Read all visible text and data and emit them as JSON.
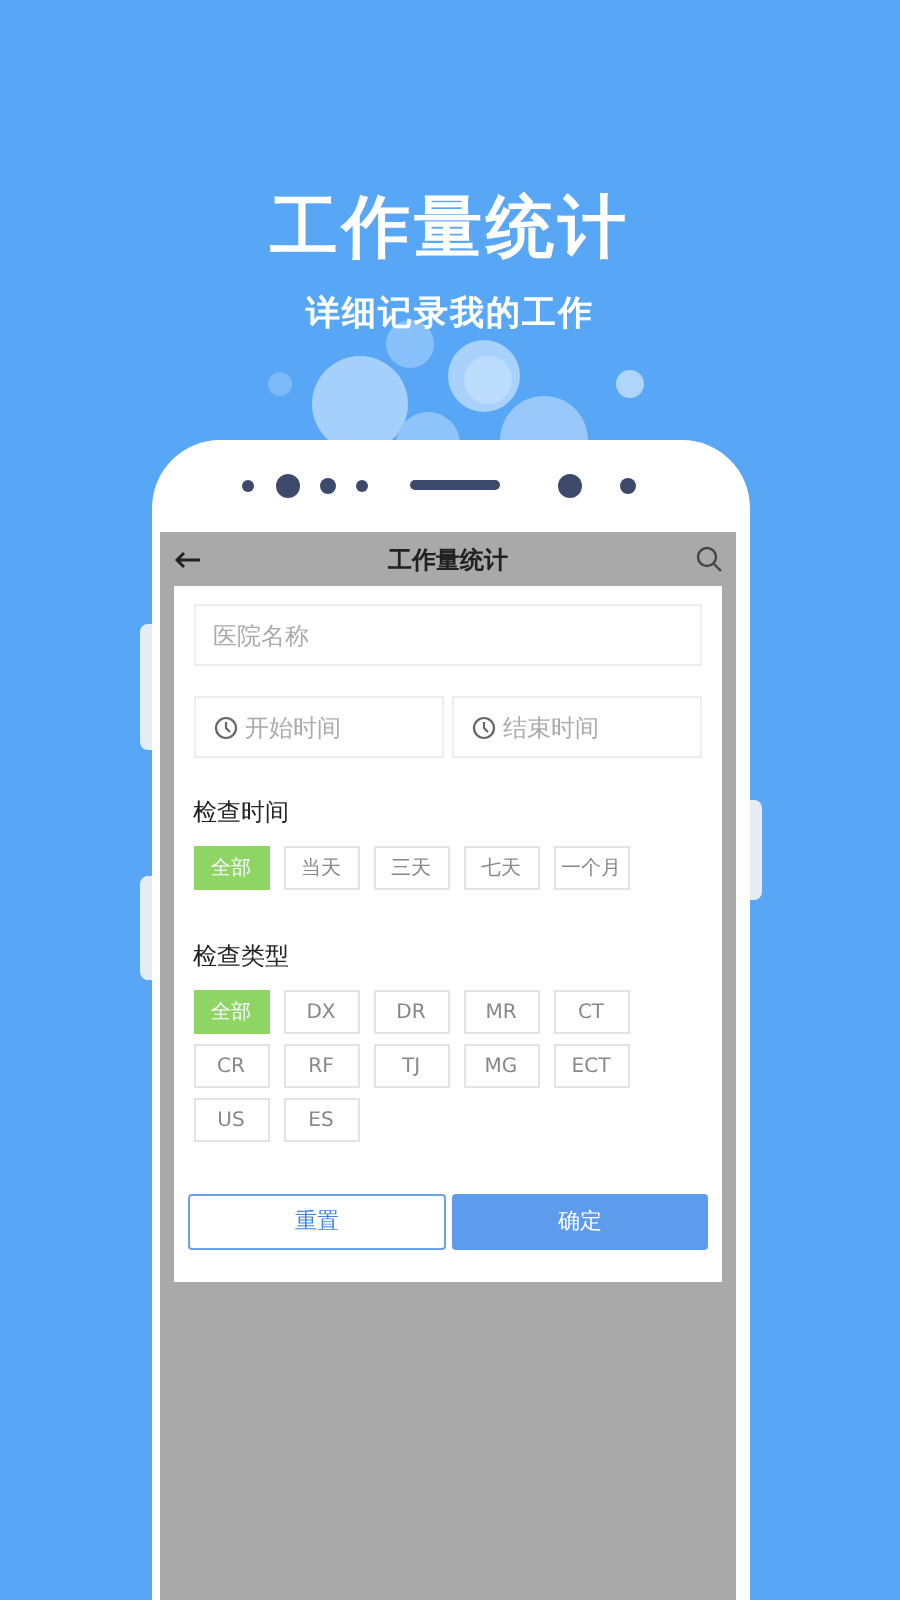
{
  "headline": "工作量统计",
  "subtitle": "详细记录我的工作",
  "app_bar": {
    "title": "工作量统计"
  },
  "form": {
    "hospital": {
      "placeholder": "医院名称"
    },
    "start_time": {
      "placeholder": "开始时间"
    },
    "end_time": {
      "placeholder": "结束时间"
    },
    "sections": [
      {
        "label": "检查时间",
        "options": [
          {
            "label": "全部",
            "selected": true
          },
          {
            "label": "当天",
            "selected": false
          },
          {
            "label": "三天",
            "selected": false
          },
          {
            "label": "七天",
            "selected": false
          },
          {
            "label": "一个月",
            "selected": false
          }
        ]
      },
      {
        "label": "检查类型",
        "options": [
          {
            "label": "全部",
            "selected": true
          },
          {
            "label": "DX",
            "selected": false
          },
          {
            "label": "DR",
            "selected": false
          },
          {
            "label": "MR",
            "selected": false
          },
          {
            "label": "CT",
            "selected": false
          },
          {
            "label": "CR",
            "selected": false
          },
          {
            "label": "RF",
            "selected": false
          },
          {
            "label": "TJ",
            "selected": false
          },
          {
            "label": "MG",
            "selected": false
          },
          {
            "label": "ECT",
            "selected": false
          },
          {
            "label": "US",
            "selected": false
          },
          {
            "label": "ES",
            "selected": false
          }
        ]
      }
    ],
    "buttons": [
      {
        "label": "重置",
        "kind": "outline"
      },
      {
        "label": "确定",
        "kind": "primary"
      }
    ]
  }
}
